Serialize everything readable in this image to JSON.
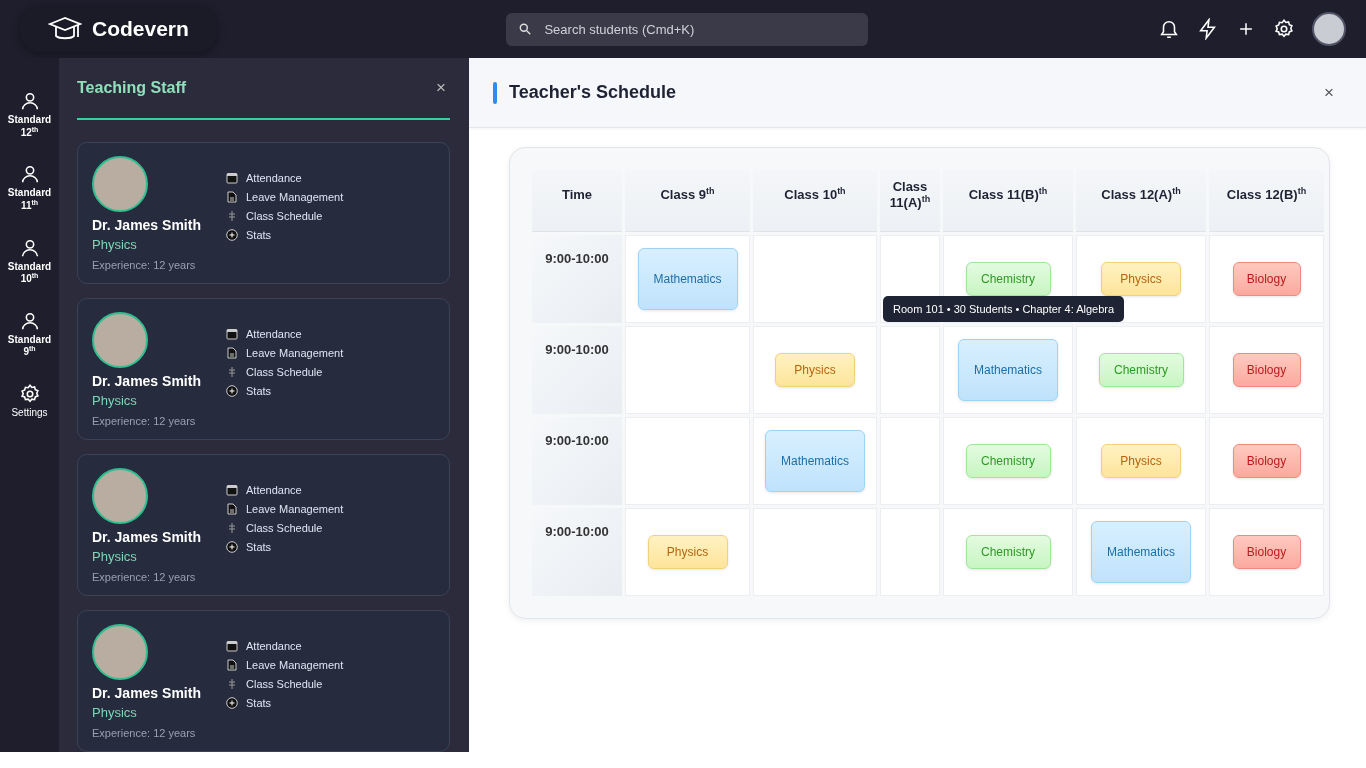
{
  "brand": {
    "name": "Codevern"
  },
  "search": {
    "placeholder": "Search students (Cmd+K)"
  },
  "sidebar": {
    "items": [
      {
        "label": "Standard 12$^{th}$",
        "kind": "person"
      },
      {
        "label": "Standard 11$^{th}$",
        "kind": "person"
      },
      {
        "label": "Standard 10$^{th}$",
        "kind": "person"
      },
      {
        "label": "Standard 9$^{th}$",
        "kind": "person"
      },
      {
        "label": "Settings",
        "kind": "settings"
      }
    ]
  },
  "staff_panel": {
    "title": "Teaching Staff",
    "close": "×",
    "cards": [
      {
        "name": "Dr. James Smith",
        "subject": "Physics",
        "experience": "Experience: 12 years",
        "actions": [
          "Attendance",
          "Leave Management",
          "Class Schedule",
          "Stats"
        ]
      },
      {
        "name": "Dr. James Smith",
        "subject": "Physics",
        "experience": "Experience: 12 years",
        "actions": [
          "Attendance",
          "Leave Management",
          "Class Schedule",
          "Stats"
        ]
      },
      {
        "name": "Dr. James Smith",
        "subject": "Physics",
        "experience": "Experience: 12 years",
        "actions": [
          "Attendance",
          "Leave Management",
          "Class Schedule",
          "Stats"
        ]
      },
      {
        "name": "Dr. James Smith",
        "subject": "Physics",
        "experience": "Experience: 12 years",
        "actions": [
          "Attendance",
          "Leave Management",
          "Class Schedule",
          "Stats"
        ]
      }
    ]
  },
  "schedule": {
    "title": "Teacher's Schedule",
    "close": "×",
    "time_column": "Time",
    "columns": [
      "Class 9$^{th}$",
      "Class 10$^{th}$",
      "Class 11(A)$^{th}$",
      "Class 11(B)$^{th}$",
      "Class 12(A)$^{th}$",
      "Class 12(B)$^{th}$"
    ],
    "rows": [
      {
        "time": "9:00-10:00",
        "cells": [
          {
            "subject": "Mathematics",
            "kind": "math"
          },
          null,
          null,
          {
            "subject": "Chemistry",
            "kind": "chemistry"
          },
          {
            "subject": "Physics",
            "kind": "physics"
          },
          {
            "subject": "Biology",
            "kind": "biology"
          }
        ]
      },
      {
        "time": "9:00-10:00",
        "cells": [
          null,
          {
            "subject": "Physics",
            "kind": "physics"
          },
          null,
          {
            "subject": "Mathematics",
            "kind": "math"
          },
          {
            "subject": "Chemistry",
            "kind": "chemistry"
          },
          {
            "subject": "Biology",
            "kind": "biology"
          }
        ]
      },
      {
        "time": "9:00-10:00",
        "cells": [
          null,
          {
            "subject": "Mathematics",
            "kind": "math"
          },
          null,
          {
            "subject": "Chemistry",
            "kind": "chemistry"
          },
          {
            "subject": "Physics",
            "kind": "physics"
          },
          {
            "subject": "Biology",
            "kind": "biology"
          }
        ]
      },
      {
        "time": "9:00-10:00",
        "cells": [
          {
            "subject": "Physics",
            "kind": "physics"
          },
          null,
          null,
          {
            "subject": "Chemistry",
            "kind": "chemistry"
          },
          {
            "subject": "Mathematics",
            "kind": "math"
          },
          {
            "subject": "Biology",
            "kind": "biology"
          }
        ]
      }
    ],
    "tooltip": "Room 101 • 30 Students • Chapter 4: Algebra"
  }
}
